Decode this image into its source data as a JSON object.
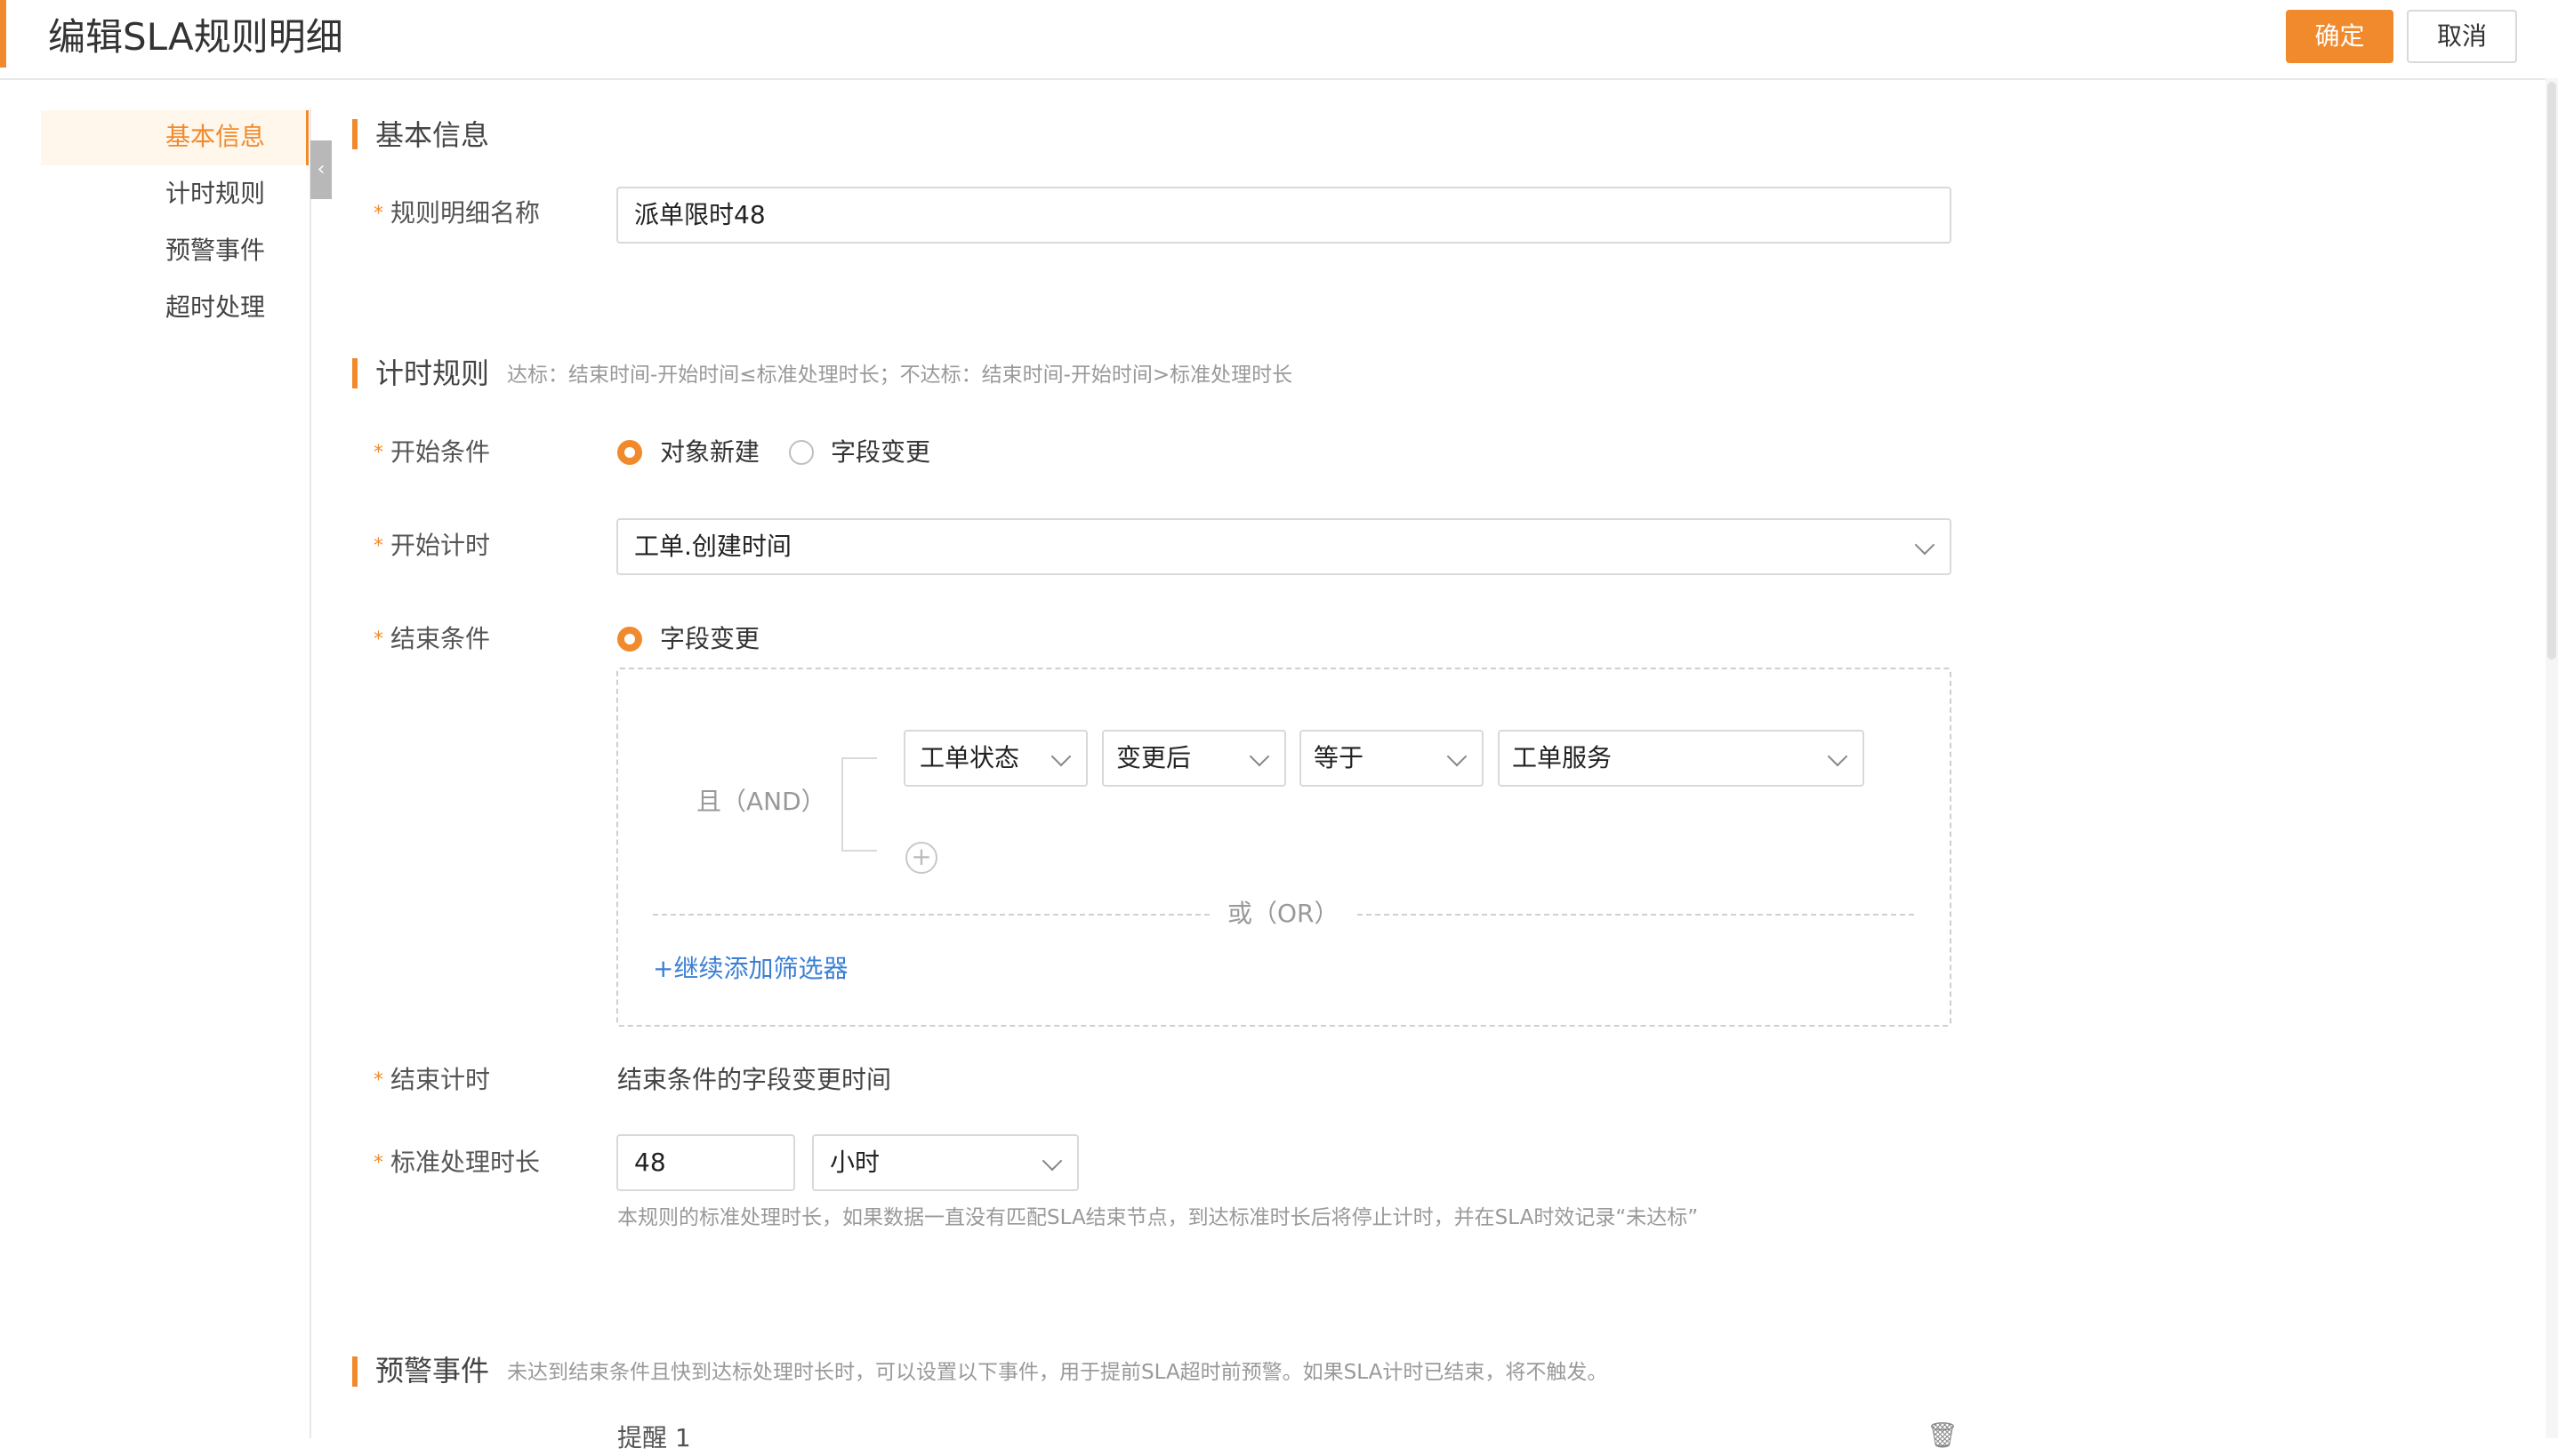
{
  "header": {
    "title": "编辑SLA规则明细",
    "confirm_label": "确定",
    "cancel_label": "取消"
  },
  "nav": {
    "items": [
      {
        "label": "基本信息",
        "active": true
      },
      {
        "label": "计时规则",
        "active": false
      },
      {
        "label": "预警事件",
        "active": false
      },
      {
        "label": "超时处理",
        "active": false
      }
    ],
    "collapse_icon": "chevron-left-icon"
  },
  "basic": {
    "title": "基本信息",
    "name_label": "规则明细名称",
    "name_value": "派单限时48"
  },
  "timing": {
    "title": "计时规则",
    "hint": "达标：结束时间-开始时间≤标准处理时长；不达标：结束时间-开始时间>标准处理时长",
    "start_condition_label": "开始条件",
    "start_condition_options": [
      "对象新建",
      "字段变更"
    ],
    "start_condition_selected": "对象新建",
    "start_time_label": "开始计时",
    "start_time_value": "工单.创建时间",
    "end_condition_label": "结束条件",
    "end_condition_option": "字段变更",
    "and_label": "且（AND）",
    "filter": {
      "field": "工单状态",
      "change": "变更后",
      "operator": "等于",
      "value": "工单服务"
    },
    "or_label": "或（OR）",
    "add_filter_label": "+继续添加筛选器",
    "end_time_label": "结束计时",
    "end_time_value": "结束条件的字段变更时间",
    "duration_label": "标准处理时长",
    "duration_value": "48",
    "duration_unit": "小时",
    "duration_hint": "本规则的标准处理时长，如果数据一直没有匹配SLA结束节点，到达标准时长后将停止计时，并在SLA时效记录“未达标”"
  },
  "warning": {
    "title": "预警事件",
    "hint": "未达到结束条件且快到达标处理时长时，可以设置以下事件，用于提前SLA超时前预警。如果SLA计时已结束，将不触发。",
    "item_label": "提醒 1"
  },
  "colors": {
    "accent": "#f08a2c",
    "link": "#3b7fd4"
  }
}
